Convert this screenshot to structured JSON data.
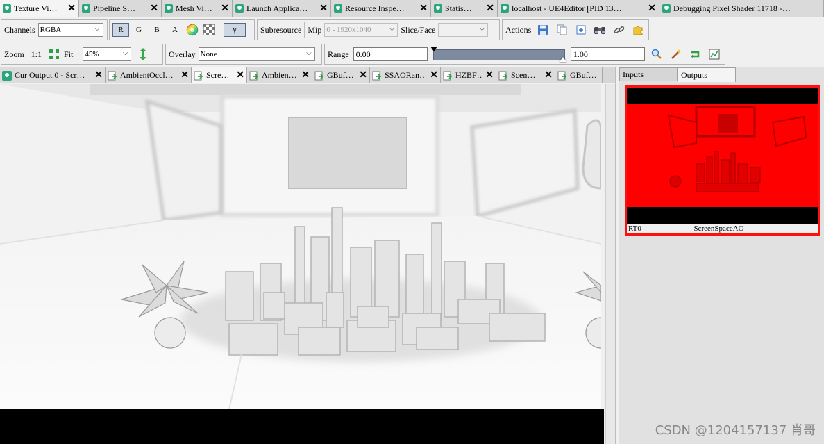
{
  "top_tabs": [
    {
      "label": "Texture Vi…",
      "active": true
    },
    {
      "label": "Pipeline S…",
      "active": false
    },
    {
      "label": "Mesh Vi…",
      "active": false
    },
    {
      "label": "Launch Applica…",
      "active": false
    },
    {
      "label": "Resource Inspe…",
      "active": false
    },
    {
      "label": "Statis…",
      "active": false
    },
    {
      "label": "localhost - UE4Editor [PID 13…",
      "active": false
    },
    {
      "label": "Debugging Pixel Shader 11718 -…",
      "active": false
    }
  ],
  "toolbar1": {
    "channels_label": "Channels",
    "channels_value": "RGBA",
    "channel_buttons": [
      "R",
      "G",
      "B",
      "A"
    ],
    "subresource_label": "Subresource",
    "mip_label": "Mip",
    "mip_value": "0 - 1920x1040",
    "slice_label": "Slice/Face",
    "slice_value": "",
    "actions_label": "Actions"
  },
  "toolbar2": {
    "zoom_label": "Zoom",
    "zoom_1to1": "1:1",
    "fit_label": "Fit",
    "zoom_value": "45%",
    "overlay_label": "Overlay",
    "overlay_value": "None",
    "range_label": "Range",
    "range_min": "0.00",
    "range_max": "1.00"
  },
  "doc_tabs": [
    {
      "label": "Cur Output 0 - Scr…",
      "active": false,
      "icon": "texture-icon"
    },
    {
      "label": "AmbientOccl…",
      "active": false,
      "icon": "resource-icon"
    },
    {
      "label": "Scre…",
      "active": true,
      "icon": "resource-icon"
    },
    {
      "label": "Ambien…",
      "active": false,
      "icon": "resource-icon"
    },
    {
      "label": "GBuf…",
      "active": false,
      "icon": "resource-icon"
    },
    {
      "label": "SSAORan…",
      "active": false,
      "icon": "resource-icon"
    },
    {
      "label": "HZBF…",
      "active": false,
      "icon": "resource-icon"
    },
    {
      "label": "Scen…",
      "active": false,
      "icon": "resource-icon"
    },
    {
      "label": "GBuf…",
      "active": false,
      "icon": "resource-icon"
    }
  ],
  "right_panel": {
    "tabs": [
      "Inputs",
      "Outputs"
    ],
    "active_tab": "Outputs",
    "thumb_slot": "RT0",
    "thumb_name": "ScreenSpaceAO"
  },
  "watermark": "CSDN @1204157137 肖哥",
  "colors": {
    "accent_tab_icon": "#2fa37a",
    "thumb_border": "#ff1010",
    "thumb_fill": "#ff0000",
    "range_bar": "#7d8aa0"
  }
}
